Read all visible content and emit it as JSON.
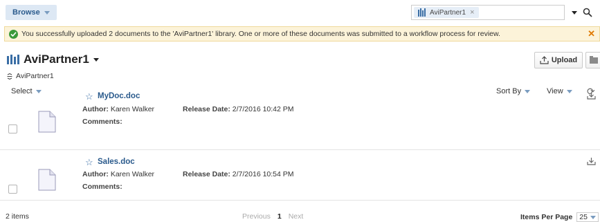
{
  "toolbar": {
    "browse_label": "Browse",
    "search_chip_label": "AviPartner1"
  },
  "banner": {
    "message": "You successfully uploaded 2 documents to the 'AviPartner1' library. One or more of these documents was submitted to a workflow process for review."
  },
  "library": {
    "title": "AviPartner1",
    "breadcrumb": "AviPartner1",
    "upload_label": "Upload"
  },
  "list_controls": {
    "select_label": "Select",
    "sort_label": "Sort By",
    "view_label": "View"
  },
  "documents": [
    {
      "name": "MyDoc.doc",
      "author_label": "Author:",
      "author": "Karen Walker",
      "release_label": "Release Date:",
      "release_date": "2/7/2016 10:42 PM",
      "comments_label": "Comments:"
    },
    {
      "name": "Sales.doc",
      "author_label": "Author:",
      "author": "Karen Walker",
      "release_label": "Release Date:",
      "release_date": "2/7/2016 10:54 PM",
      "comments_label": "Comments:"
    }
  ],
  "footer": {
    "item_count": "2 items",
    "previous": "Previous",
    "page": "1",
    "next": "Next",
    "items_per_page_label": "Items Per Page",
    "items_per_page": "25"
  },
  "colors": {
    "accent": "#3a6ea5",
    "banner_bg": "#fcf3d9",
    "success": "#3a9a3a",
    "close": "#e07a00"
  }
}
